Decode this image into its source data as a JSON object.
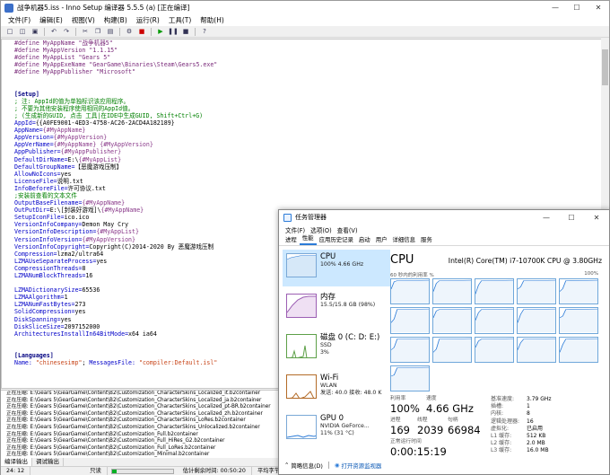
{
  "inno": {
    "title": "战争机器5.iss - Inno Setup 编译器 5.5.5 (a)  [正在编译]",
    "menu": [
      "文件(F)",
      "编辑(E)",
      "视图(V)",
      "构建(B)",
      "运行(R)",
      "工具(T)",
      "帮助(H)"
    ],
    "code": [
      [
        [
          "c-def",
          "#define MyAppName \"战争机器5\""
        ]
      ],
      [
        [
          "c-def",
          "#define MyAppVersion \"1.1.15\""
        ]
      ],
      [
        [
          "c-def",
          "#define MyAppList \"Gears 5\""
        ]
      ],
      [
        [
          "c-def",
          "#define MyAppExeName \"GearGame\\Binaries\\Steam\\Gears5.exe\""
        ]
      ],
      [
        [
          "c-def",
          "#define MyAppPublisher \"Microsoft\""
        ]
      ],
      [
        [
          "c-val",
          ""
        ]
      ],
      [
        [
          "c-val",
          ""
        ]
      ],
      [
        [
          "c-sec",
          "[Setup]"
        ]
      ],
      [
        [
          "c-com",
          "; 注: AppId的值为单独标识该应用程序。"
        ]
      ],
      [
        [
          "c-com",
          "; 不要为其他安装程序使用相同的AppId值。"
        ]
      ],
      [
        [
          "c-com",
          "; (生成新的GUID, 点击 工具|在IDE中生成GUID, Shift+Ctrl+G)"
        ]
      ],
      [
        [
          "c-key",
          "AppId="
        ],
        [
          "c-val",
          "{{A0FE9001-4ED3-4758-AC26-2ACD4A182189}"
        ]
      ],
      [
        [
          "c-key",
          "AppName="
        ],
        [
          "c-con",
          "{#MyAppName}"
        ]
      ],
      [
        [
          "c-key",
          "AppVersion="
        ],
        [
          "c-con",
          "{#MyAppVersion}"
        ]
      ],
      [
        [
          "c-key",
          "AppVerName="
        ],
        [
          "c-con",
          "{#MyAppName} {#MyAppVersion}"
        ]
      ],
      [
        [
          "c-key",
          "AppPublisher="
        ],
        [
          "c-con",
          "{#MyAppPublisher}"
        ]
      ],
      [
        [
          "c-key",
          "DefaultDirName="
        ],
        [
          "c-val",
          "E:\\"
        ],
        [
          "c-con",
          "{#MyAppList}"
        ]
      ],
      [
        [
          "c-key",
          "DefaultGroupName="
        ],
        [
          "c-val",
          "【恶魔游戏压制】"
        ]
      ],
      [
        [
          "c-key",
          "AllowNoIcons="
        ],
        [
          "c-val",
          "yes"
        ]
      ],
      [
        [
          "c-key",
          "LicenseFile="
        ],
        [
          "c-val",
          "说明.txt"
        ]
      ],
      [
        [
          "c-key",
          "InfoBeforeFile="
        ],
        [
          "c-val",
          "许可协议.txt"
        ]
      ],
      [
        [
          "c-com",
          ";安装前查看的文本文件"
        ]
      ],
      [
        [
          "c-key",
          "OutputBaseFilename="
        ],
        [
          "c-con",
          "{#MyAppName}"
        ]
      ],
      [
        [
          "c-key",
          "OutPutDir="
        ],
        [
          "c-val",
          "E:\\[封装好游戏]\\"
        ],
        [
          "c-con",
          "{#MyAppName}"
        ]
      ],
      [
        [
          "c-key",
          "SetupIconFile="
        ],
        [
          "c-val",
          "ico.ico"
        ]
      ],
      [
        [
          "c-key",
          "VersionInfoCompany="
        ],
        [
          "c-val",
          "Demon May Cry"
        ]
      ],
      [
        [
          "c-key",
          "VersionInfoDescription="
        ],
        [
          "c-con",
          "{#MyAppList}"
        ]
      ],
      [
        [
          "c-key",
          "VersionInfoVersion="
        ],
        [
          "c-con",
          "{#MyAppVersion}"
        ]
      ],
      [
        [
          "c-key",
          "VersionInfoCopyright="
        ],
        [
          "c-val",
          "Copyright(C)2014-2020 By 恶魔游戏压制"
        ]
      ],
      [
        [
          "c-key",
          "Compression="
        ],
        [
          "c-val",
          "lzma2/ultra64"
        ]
      ],
      [
        [
          "c-key",
          "LZMAUseSeparateProcess="
        ],
        [
          "c-val",
          "yes"
        ]
      ],
      [
        [
          "c-key",
          "CompressionThreads="
        ],
        [
          "c-val",
          "8"
        ]
      ],
      [
        [
          "c-key",
          "LZMANumBlockThreads="
        ],
        [
          "c-val",
          "16"
        ]
      ],
      [
        [
          "c-val",
          ""
        ]
      ],
      [
        [
          "c-key",
          "LZMADictionarySize="
        ],
        [
          "c-val",
          "65536"
        ]
      ],
      [
        [
          "c-key",
          "LZMAAlgorithm="
        ],
        [
          "c-val",
          "1"
        ]
      ],
      [
        [
          "c-key",
          "LZMANumFastBytes="
        ],
        [
          "c-val",
          "273"
        ]
      ],
      [
        [
          "c-key",
          "SolidCompression="
        ],
        [
          "c-val",
          "yes"
        ]
      ],
      [
        [
          "c-key",
          "DiskSpanning="
        ],
        [
          "c-val",
          "yes"
        ]
      ],
      [
        [
          "c-key",
          "DiskSliceSize="
        ],
        [
          "c-val",
          "2097152000"
        ]
      ],
      [
        [
          "c-key",
          "ArchitecturesInstallIn64BitMode="
        ],
        [
          "c-val",
          "x64 ia64"
        ]
      ],
      [
        [
          "c-val",
          ""
        ]
      ],
      [
        [
          "c-val",
          ""
        ]
      ],
      [
        [
          "c-sec",
          "[Languages]"
        ]
      ],
      [
        [
          "c-key",
          "Name: "
        ],
        [
          "c-str",
          "\"chinesesimp\""
        ],
        [
          "c-val",
          "; "
        ],
        [
          "c-key",
          "MessagesFile: "
        ],
        [
          "c-str",
          "\"compiler:Default.isl\""
        ]
      ]
    ],
    "output": [
      "正在压缩: E:\\Gears 5\\GearGame\\Content\\B2\\Customization_CharacterSkins_Localized_it.b2container",
      "正在压缩: E:\\Gears 5\\GearGame\\Content\\B2\\Customization_CharacterSkins_Localized_ja.b2container",
      "正在压缩: E:\\Gears 5\\GearGame\\Content\\B2\\Customization_CharacterSkins_Localized_pt-BR.b2container",
      "正在压缩: E:\\Gears 5\\GearGame\\Content\\B2\\Customization_CharacterSkins_Localized_zh.b2container",
      "正在压缩: E:\\Gears 5\\GearGame\\Content\\B2\\Customization_CharacterSkins_LoRes.b2container",
      "正在压缩: E:\\Gears 5\\GearGame\\Content\\B2\\Customization_CharacterSkins_Unlocalized.b2container",
      "正在压缩: E:\\Gears 5\\GearGame\\Content\\B2\\Customization_Full.b2container",
      "正在压缩: E:\\Gears 5\\GearGame\\Content\\B2\\Customization_Full_HiRes_G2.b2container",
      "正在压缩: E:\\Gears 5\\GearGame\\Content\\B2\\Customization_Full_LoRes.b2container",
      "正在压缩: E:\\Gears 5\\GearGame\\Content\\B2\\Customization_Minimal.b2container"
    ],
    "tabs": {
      "compile": "编译输出",
      "debug": "调试输出"
    },
    "status": {
      "position": "24: 12",
      "mode": "只读",
      "progress": 0.07,
      "remaining": "估计剩余时间: 00:50:20",
      "speed": "平均字节/秒: 22,883"
    }
  },
  "tm": {
    "title": "任务管理器",
    "menu": [
      "文件(F)",
      "选项(O)",
      "查看(V)"
    ],
    "tabs": [
      "进程",
      "性能",
      "应用历史记录",
      "启动",
      "用户",
      "详细信息",
      "服务"
    ],
    "side": [
      {
        "name": "CPU",
        "sub": [
          "100%  4.66 GHz"
        ]
      },
      {
        "name": "内存",
        "sub": [
          "15.5/15.8 GB (98%)"
        ]
      },
      {
        "name": "磁盘 0 (C: D: E:)",
        "sub": [
          "SSD",
          "3%"
        ]
      },
      {
        "name": "Wi-Fi",
        "sub": [
          "WLAN",
          "发送: 40.0  接收: 48.0 K"
        ]
      },
      {
        "name": "GPU 0",
        "sub": [
          "NVIDIA GeForce...",
          "11% (31 °C)"
        ]
      }
    ],
    "cpu_title": "CPU",
    "cpu_model": "Intel(R) Core(TM) i7-10700K CPU @ 3.80GHz",
    "graph_label": "60 秒内的利用率 %",
    "graph_max": "100%",
    "stats": {
      "util_label": "利用率",
      "util": "100%",
      "speed_label": "速度",
      "speed": "4.66 GHz",
      "proc_label": "进程",
      "proc": "169",
      "threads_label": "线程",
      "threads": "2039",
      "handles_label": "句柄",
      "handles": "66984",
      "uptime_label": "正常运行时间",
      "uptime": "0:00:15:19"
    },
    "kv": [
      [
        "基准速度:",
        "3.79 GHz"
      ],
      [
        "插槽:",
        "1"
      ],
      [
        "内核:",
        "8"
      ],
      [
        "逻辑处理器:",
        "16"
      ],
      [
        "虚拟化:",
        "已启用"
      ],
      [
        "L1 缓存:",
        "512 KB"
      ],
      [
        "L2 缓存:",
        "2.0 MB"
      ],
      [
        "L3 缓存:",
        "16.0 MB"
      ]
    ],
    "footer": {
      "less": "简略信息(D)",
      "monitor": "打开资源监视器"
    },
    "accent": "#2b7bd8"
  }
}
